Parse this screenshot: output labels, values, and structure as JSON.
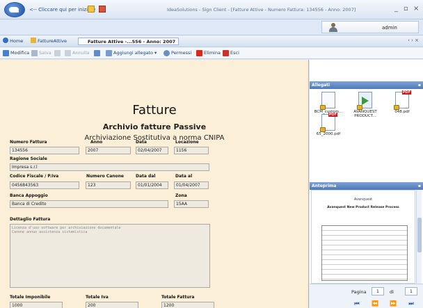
{
  "titlebar": {
    "back_link": "<-- Cliccare qui per iniziare",
    "window_title": "IdeaSolutions - Sign Client - [Fatture Attive - Numero Fattura: 134556 - Anno: 2007]",
    "min": "_",
    "restore": "▫",
    "close": "×"
  },
  "user": {
    "name": "admin"
  },
  "breadcrumb": {
    "home": "Home",
    "fatture_attive": "FattureAttive",
    "current": "Fatture Attive -...556 - Anno: 2007",
    "nav": "‹ › ×"
  },
  "toolbar": {
    "modifica": "Modifica",
    "salva": "Salva",
    "annulla": "Annulla",
    "aggiungi_allegato": "Aggiungi allegato",
    "permessi": "Permessi",
    "elimina": "Elimina",
    "esci": "Esci"
  },
  "doc": {
    "title": "Fatture",
    "subtitle": "Archivio fatture Passive",
    "subtitle2": "Archiviazione Sostitutiva a norma CNIPA",
    "labels": {
      "numero_fattura": "Numero Fattura",
      "anno": "Anno",
      "data": "Data",
      "locazione": "Locazione",
      "ragione_sociale": "Ragione Sociale",
      "codice_fiscale": "Codice Fiscale / P.Iva",
      "numero_canone": "Numero Canone",
      "data_dal": "Data dal",
      "data_al": "Data al",
      "banca_appoggio": "Banca Appoggio",
      "zona": "Zona",
      "dettaglio_fattura": "Dettaglio Fattura",
      "totale_imponibile": "Totale Imponibile",
      "totale_iva": "Totale Iva",
      "totale_fattura": "Totale Fattura"
    },
    "values": {
      "numero_fattura": "134556",
      "anno": "2007",
      "data": "02/04/2007",
      "locazione": "1156",
      "ragione_sociale": "Impresa s.r.l",
      "codice_fiscale": "0456843563",
      "numero_canone": "123",
      "data_dal": "01/01/2004",
      "data_al": "01/04/2007",
      "banca_appoggio": "Banca di Credito",
      "zona": "15AA",
      "dettaglio_fattura": "Licenza d'uso software per archiviazione documentale\nCanone annuo assistenza sistemistica",
      "totale_imponibile": "1000",
      "totale_iva": "200",
      "totale_fattura": "1200"
    }
  },
  "allegati": {
    "title": "Allegati",
    "files": [
      {
        "name": "BCM_custom...",
        "icon": "document-lock-icon"
      },
      {
        "name": "AVANQUEST PRODUCT...",
        "icon": "arrow-doc-lock-icon"
      },
      {
        "name": "048.pdf",
        "icon": "pdf-lock-icon"
      },
      {
        "name": "65_2000.pdf",
        "icon": "pdf-lock-icon"
      }
    ]
  },
  "anteprima": {
    "title": "Anteprima",
    "doc_logo": "Avanquest",
    "doc_title": "Avanquest New Product Release Process"
  },
  "pager": {
    "label": "Pagina",
    "current": "1",
    "of": "di",
    "total": "1"
  },
  "colors": {
    "doc_bg": "#fbf0d7",
    "panel_header": "#4f78b8",
    "accent": "#1f5bb5"
  }
}
